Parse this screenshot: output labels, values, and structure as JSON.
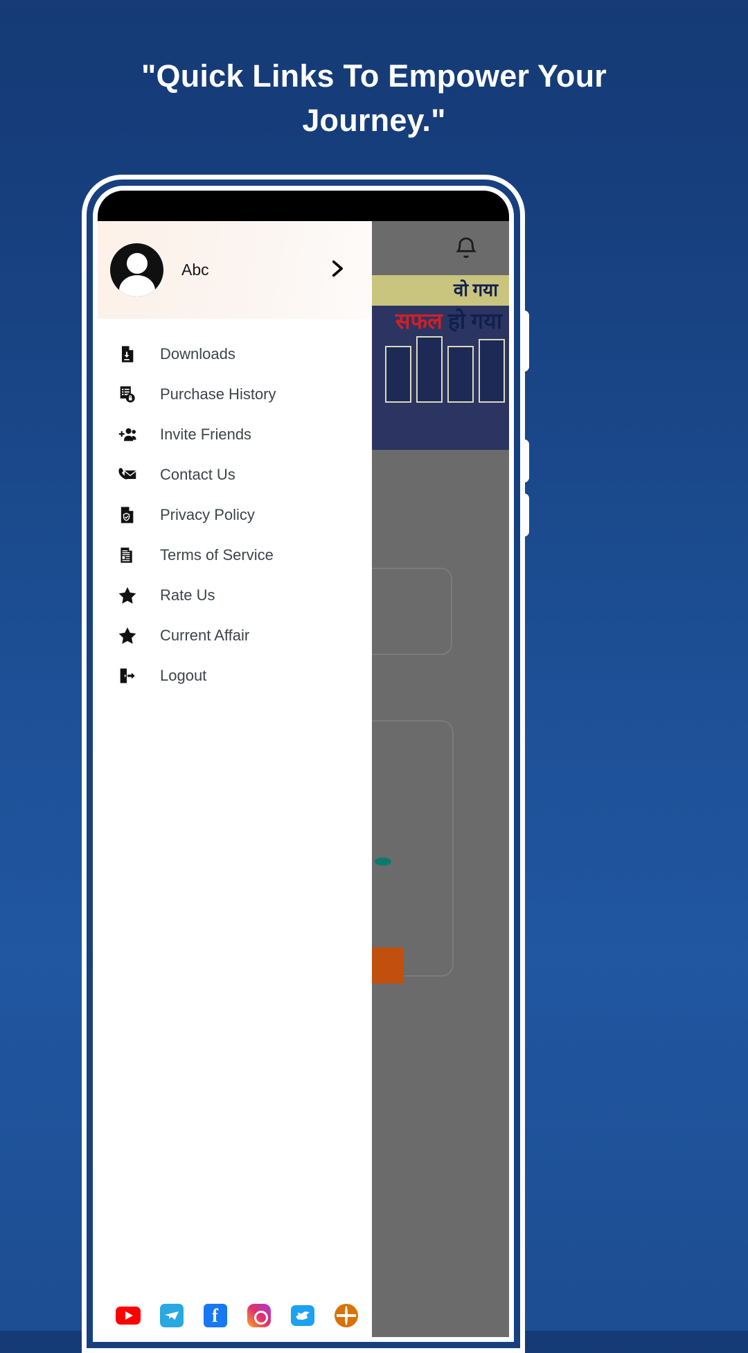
{
  "headline": "\"Quick Links To Empower Your Journey.\"",
  "phone": {
    "status_bar": "",
    "drawer": {
      "profile": {
        "name": "Abc",
        "avatar_icon": "user-avatar-icon",
        "chevron_icon": "chevron-right-icon"
      },
      "menu_items": [
        {
          "label": "Downloads",
          "icon": "file-download-icon"
        },
        {
          "label": "Purchase History",
          "icon": "receipt-lock-icon"
        },
        {
          "label": "Invite Friends",
          "icon": "person-add-icon"
        },
        {
          "label": "Contact Us",
          "icon": "phone-envelope-icon"
        },
        {
          "label": "Privacy Policy",
          "icon": "document-shield-icon"
        },
        {
          "label": "Terms of Service",
          "icon": "document-text-icon"
        },
        {
          "label": "Rate Us",
          "icon": "star-icon"
        },
        {
          "label": "Current Affair",
          "icon": "star-icon"
        },
        {
          "label": "Logout",
          "icon": "logout-icon"
        }
      ],
      "social_links": [
        {
          "name": "youtube",
          "icon": "youtube-icon"
        },
        {
          "name": "telegram",
          "icon": "telegram-icon"
        },
        {
          "name": "facebook",
          "icon": "facebook-icon"
        },
        {
          "name": "instagram",
          "icon": "instagram-icon"
        },
        {
          "name": "twitter",
          "icon": "twitter-icon"
        },
        {
          "name": "website",
          "icon": "globe-icon"
        }
      ]
    },
    "background_app": {
      "notification_icon": "bell-icon",
      "banner_line1": "वो गया",
      "banner_line2_red": "सफल",
      "banner_line2_dark": " हो गया"
    }
  },
  "colors": {
    "page_background_top": "#153a75",
    "page_background_bottom": "#1d4d92",
    "headline_text": "#ffffff",
    "drawer_background": "#ffffff",
    "profile_header": "#fdf1e8",
    "menu_label": "#3d4449",
    "icon": "#000000",
    "scrim": "#6b6b6b"
  }
}
